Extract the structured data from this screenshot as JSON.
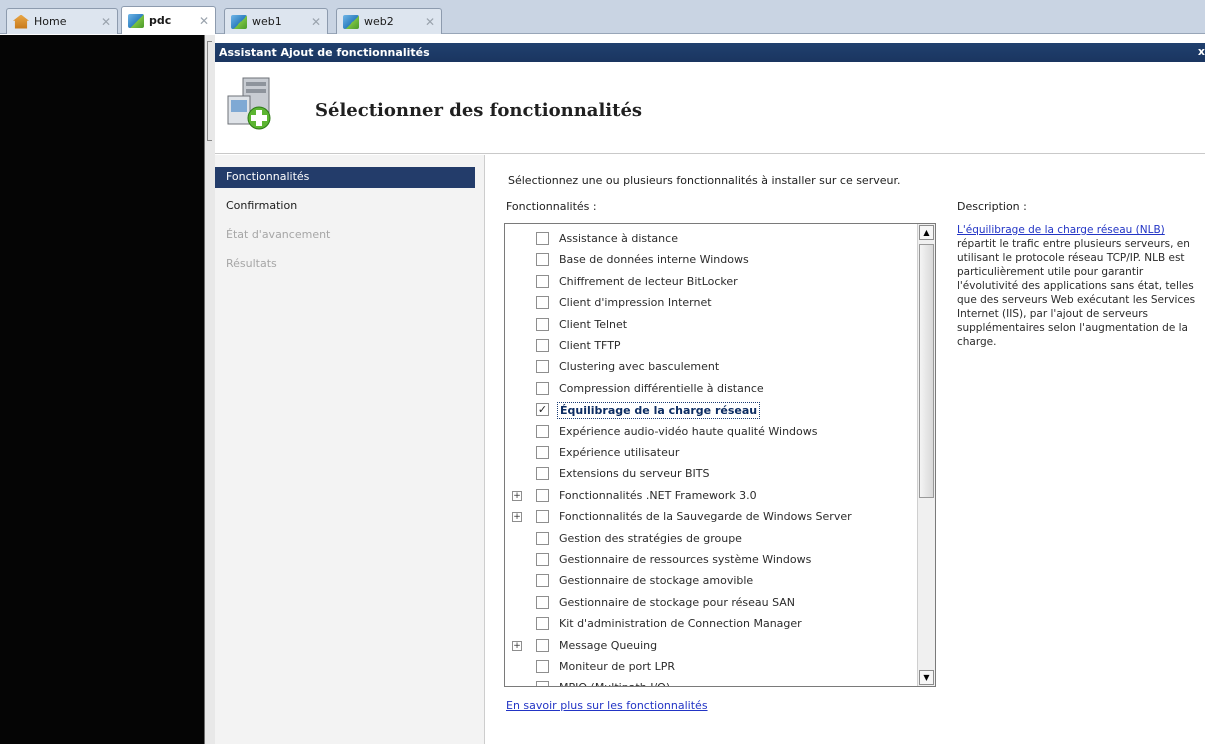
{
  "tabs": [
    {
      "label": "Home",
      "icon": "home-icon"
    },
    {
      "label": "pdc",
      "icon": "vm-icon"
    },
    {
      "label": "web1",
      "icon": "vm-icon"
    },
    {
      "label": "web2",
      "icon": "vm-icon"
    }
  ],
  "tab_close_glyph": "✕",
  "wizard": {
    "window_title": "Assistant Ajout de fonctionnalités",
    "close_glyph": "x",
    "page_title": "Sélectionner des fonctionnalités"
  },
  "nav": {
    "items": [
      {
        "label": "Fonctionnalités",
        "state": "active"
      },
      {
        "label": "Confirmation",
        "state": "normal"
      },
      {
        "label": "État d'avancement",
        "state": "disabled"
      },
      {
        "label": "Résultats",
        "state": "disabled"
      }
    ]
  },
  "main": {
    "intro": "Sélectionnez une ou plusieurs fonctionnalités à installer sur ce serveur.",
    "list_label": "Fonctionnalités :",
    "features": [
      {
        "label": "Assistance à distance",
        "checked": false,
        "expandable": false
      },
      {
        "label": "Base de données interne Windows",
        "checked": false,
        "expandable": false
      },
      {
        "label": "Chiffrement de lecteur BitLocker",
        "checked": false,
        "expandable": false
      },
      {
        "label": "Client d'impression Internet",
        "checked": false,
        "expandable": false
      },
      {
        "label": "Client Telnet",
        "checked": false,
        "expandable": false
      },
      {
        "label": "Client TFTP",
        "checked": false,
        "expandable": false
      },
      {
        "label": "Clustering avec basculement",
        "checked": false,
        "expandable": false
      },
      {
        "label": "Compression différentielle à distance",
        "checked": false,
        "expandable": false
      },
      {
        "label": "Équilibrage de la charge réseau",
        "checked": true,
        "expandable": false,
        "selected": true
      },
      {
        "label": "Expérience audio-vidéo haute qualité Windows",
        "checked": false,
        "expandable": false
      },
      {
        "label": "Expérience utilisateur",
        "checked": false,
        "expandable": false
      },
      {
        "label": "Extensions du serveur BITS",
        "checked": false,
        "expandable": false
      },
      {
        "label": "Fonctionnalités .NET Framework 3.0",
        "checked": false,
        "expandable": true
      },
      {
        "label": "Fonctionnalités de la Sauvegarde de Windows Server",
        "checked": false,
        "expandable": true
      },
      {
        "label": "Gestion des stratégies de groupe",
        "checked": false,
        "expandable": false
      },
      {
        "label": "Gestionnaire de ressources système Windows",
        "checked": false,
        "expandable": false
      },
      {
        "label": "Gestionnaire de stockage amovible",
        "checked": false,
        "expandable": false
      },
      {
        "label": "Gestionnaire de stockage pour réseau SAN",
        "checked": false,
        "expandable": false
      },
      {
        "label": "Kit d'administration de Connection Manager",
        "checked": false,
        "expandable": false
      },
      {
        "label": "Message Queuing",
        "checked": false,
        "expandable": true
      },
      {
        "label": "Moniteur de port LPR",
        "checked": false,
        "expandable": false
      },
      {
        "label": "MPIO (Multipath I/O)",
        "checked": false,
        "expandable": false
      }
    ],
    "expander_glyph": "+",
    "check_glyph": "✓",
    "scroll_up_glyph": "▲",
    "scroll_down_glyph": "▼",
    "learn_more_link": "En savoir plus sur les fonctionnalités",
    "description_label": "Description :",
    "description_link": "L'équilibrage de la charge réseau (NLB)",
    "description_text": " répartit le trafic entre plusieurs serveurs, en utilisant le protocole réseau TCP/IP. NLB est particulièrement utile pour garantir l'évolutivité des applications sans état, telles que des serveurs Web exécutant les Services Internet (IIS), par l'ajout de serveurs supplémentaires selon l'augmentation de la charge."
  }
}
